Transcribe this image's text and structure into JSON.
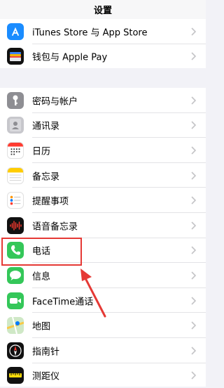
{
  "nav": {
    "title": "设置"
  },
  "group1": [
    {
      "label": "iTunes Store 与 App Store",
      "icon": "app-store-icon"
    },
    {
      "label": "钱包与 Apple Pay",
      "icon": "wallet-icon"
    }
  ],
  "group2": [
    {
      "label": "密码与帐户",
      "icon": "key-icon"
    },
    {
      "label": "通讯录",
      "icon": "contacts-icon"
    },
    {
      "label": "日历",
      "icon": "calendar-icon"
    },
    {
      "label": "备忘录",
      "icon": "notes-icon"
    },
    {
      "label": "提醒事项",
      "icon": "reminders-icon"
    },
    {
      "label": "语音备忘录",
      "icon": "voice-memos-icon"
    },
    {
      "label": "电话",
      "icon": "phone-icon"
    },
    {
      "label": "信息",
      "icon": "messages-icon"
    },
    {
      "label": "FaceTime通话",
      "icon": "facetime-icon"
    },
    {
      "label": "地图",
      "icon": "maps-icon"
    },
    {
      "label": "指南针",
      "icon": "compass-icon"
    },
    {
      "label": "测距仪",
      "icon": "measure-icon"
    }
  ],
  "colors": {
    "highlight": "#e53935",
    "phone_green": "#34c759",
    "app_store_blue": "#1a8cff"
  }
}
